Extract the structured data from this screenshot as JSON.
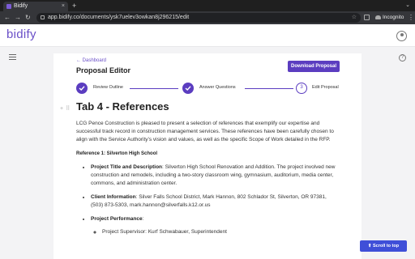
{
  "browser": {
    "tab_title": "Bidify",
    "tab_close": "×",
    "new_tab": "+",
    "url": "app.bidify.co/documents/ysk7uelev3owkan8j296215/edit",
    "profile_label": "Incognito",
    "nav": {
      "back": "←",
      "forward": "→",
      "reload": "↻"
    },
    "menu": "⋮",
    "star": "☆"
  },
  "app": {
    "logo": "bidify",
    "help": "?"
  },
  "editor": {
    "breadcrumb": "← Dashboard",
    "title": "Proposal Editor",
    "download_label": "Download Proposal",
    "steps": [
      {
        "label": "Review Outline",
        "state": "done"
      },
      {
        "label": "Answer Questions",
        "state": "done"
      },
      {
        "label": "Edit Proposal",
        "state": "current",
        "number": "3"
      }
    ]
  },
  "doc": {
    "heading": "Tab 4 - References",
    "intro": "LCG Pence Construction is pleased to present a selection of references that exemplify our expertise and successful track record in construction management services. These references have been carefully chosen to align with the Service Authority’s vision and values, as well as the specific Scope of Work detailed in the RFP.",
    "reference_title": "Reference 1: Silverton High School",
    "items": [
      {
        "label": "Project Title and Description",
        "text": ": Silverton High School Renovation and Addition. The project involved new construction and remodels, including a two-story classroom wing, gymnasium, auditorium, media center, commons, and administration center."
      },
      {
        "label": "Client Information",
        "text": ": Silver Falls School District, Mark Hannon, 802 Schlador St, Silverton, OR 97381, (503) 873-5303, mark.hannon@silverfalls.k12.or.us"
      },
      {
        "label": "Project Performance",
        "text": ":"
      }
    ],
    "sub_items": [
      "Project Supervisor: Kurf Schwabauer, Superintendent"
    ]
  },
  "scroll_top_label": "Scroll to top",
  "colors": {
    "accent": "#5b3dc0",
    "logo": "#6a4fc8",
    "scroll_button": "#3f4fd8"
  }
}
